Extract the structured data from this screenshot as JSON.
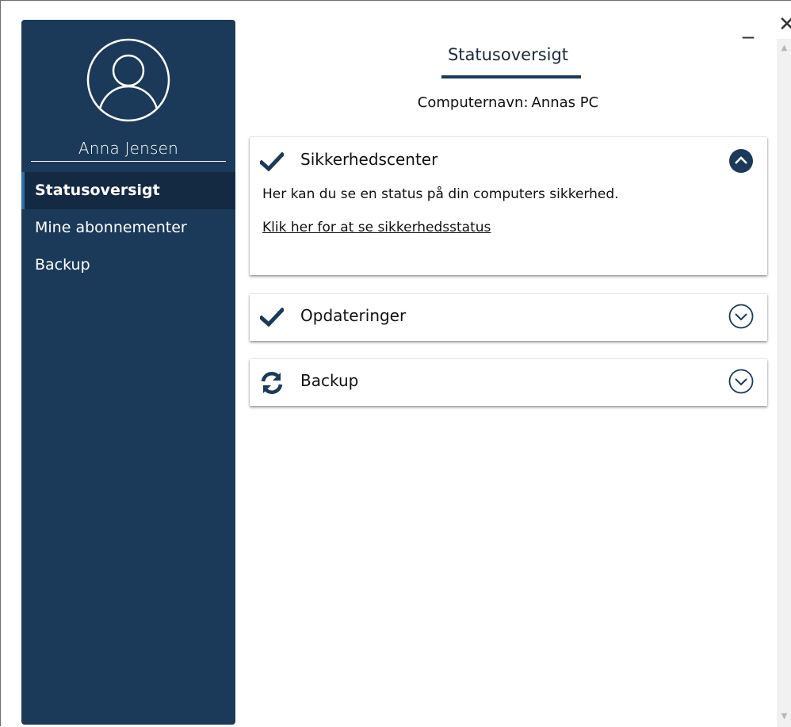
{
  "window": {
    "minimize_glyph": "_",
    "close_glyph": "✕"
  },
  "sidebar": {
    "user_name": "Anna Jensen",
    "items": [
      {
        "label": "Statusoversigt",
        "active": true
      },
      {
        "label": "Mine abonnementer",
        "active": false
      },
      {
        "label": "Backup",
        "active": false
      }
    ]
  },
  "main": {
    "title": "Statusoversigt",
    "computer_label": "Computernavn:",
    "computer_name": "Annas PC",
    "cards": [
      {
        "title": "Sikkerhedscenter",
        "status_icon": "check-icon",
        "expanded": true,
        "description": "Her kan du se en status på din computers sikkerhed.",
        "link": "Klik her for at se sikkerhedsstatus"
      },
      {
        "title": "Opdateringer",
        "status_icon": "check-icon",
        "expanded": false
      },
      {
        "title": "Backup",
        "status_icon": "sync-icon",
        "expanded": false
      }
    ]
  },
  "colors": {
    "sidebar_bg": "#1b3a59",
    "active_item_bg": "#132a42",
    "accent": "#1b3a59"
  }
}
